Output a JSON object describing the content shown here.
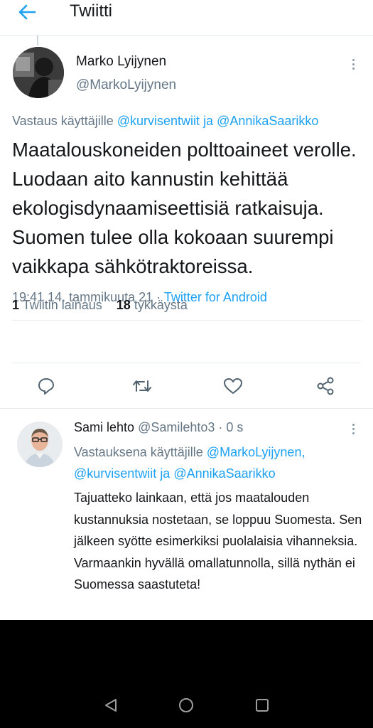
{
  "header": {
    "title": "Twiitti"
  },
  "main_tweet": {
    "author_name": "Marko Lyijynen",
    "author_handle": "@MarkoLyijynen",
    "reply_prefix": "Vastaus käyttäjille",
    "reply_user1": "@kurvisentwiit",
    "reply_and": "ja",
    "reply_user2": "@AnnikaSaarikko",
    "text": "Maatalouskoneiden polttoaineet verolle. Luodaan aito kannustin kehittää ekologisdynaamiseettisiä ratkaisuja. Suomen tulee olla kokoaan suurempi vaikkapa sähkötraktoreissa.",
    "time": "19:41 14. tammikuuta 21",
    "separator": "·",
    "source": "Twitter for Android",
    "quote_count": "1",
    "quote_label": "Twiitin lainaus",
    "like_count": "18",
    "like_label": "tykkäystä"
  },
  "reply_tweet": {
    "author_name": "Sami lehto",
    "author_handle": "@Samilehto3",
    "time_sep": "·",
    "time": "0 s",
    "reply_prefix": "Vastauksena käyttäjille",
    "reply_user1": "@MarkoLyijynen,",
    "reply_user2": "@kurvisentwiit",
    "reply_and": "ja",
    "reply_user3": "@AnnikaSaarikko",
    "text": "Tajuatteko lainkaan, että jos maatalouden kustannuksia nostetaan, se loppuu Suomesta. Sen jälkeen syötte esimerkiksi puolalaisia vihanneksia. Varmaankin hyvällä omallatunnolla, sillä nythän ei Suomessa saastuteta!"
  },
  "icons": {
    "back": "back-arrow-icon",
    "more": "more-vertical-icon",
    "reply": "reply-icon",
    "retweet": "retweet-icon",
    "like": "heart-icon",
    "share": "share-icon",
    "nav_back": "nav-back-icon",
    "nav_home": "nav-home-icon",
    "nav_recents": "nav-recents-icon"
  },
  "colors": {
    "accent": "#1da1f2",
    "secondary_text": "#657786",
    "primary_text": "#14171a",
    "navbar": "#000000"
  }
}
